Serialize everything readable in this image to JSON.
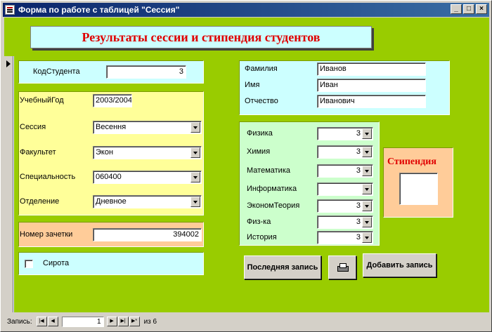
{
  "window": {
    "title": "Форма по работе с таблицей \"Сессия\""
  },
  "header": {
    "title": "Результаты сессии и стипендия студентов"
  },
  "student_id": {
    "label": "КодСтудента",
    "value": "3"
  },
  "session_info": {
    "year_label": "УчебныйГод",
    "year_value": "2003/2004",
    "session_label": "Сессия",
    "session_value": "Весення",
    "faculty_label": "Факультет",
    "faculty_value": "Экон",
    "specialty_label": "Специальность",
    "specialty_value": "060400",
    "department_label": "Отделение",
    "department_value": "Дневное"
  },
  "record_book": {
    "label": "Номер зачетки",
    "value": "394002"
  },
  "orphan": {
    "label": "Сирота"
  },
  "name": {
    "last_label": "Фамилия",
    "last_value": "Иванов",
    "first_label": "Имя",
    "first_value": "Иван",
    "middle_label": "Отчество",
    "middle_value": "Иванович"
  },
  "grades": [
    {
      "label": "Физика",
      "value": "3"
    },
    {
      "label": "Химия",
      "value": "3"
    },
    {
      "label": "Математика",
      "value": "3"
    },
    {
      "label": "Информатика",
      "value": ""
    },
    {
      "label": "ЭкономТеория",
      "value": "3"
    },
    {
      "label": "Физ-ка",
      "value": "3"
    },
    {
      "label": "История",
      "value": "3"
    }
  ],
  "scholarship": {
    "label": "Стипендия"
  },
  "buttons": {
    "last_record": "Последняя запись",
    "add_record": "Добавить запись"
  },
  "navigator": {
    "label": "Запись:",
    "current": "1",
    "of_label": "из 6"
  },
  "colors": {
    "form_bg": "#99cc00",
    "title_red": "#e00000",
    "panel_cyan": "#ccffff",
    "panel_yellow": "#ffff99",
    "panel_peach": "#ffcc99",
    "panel_green": "#ccffcc"
  }
}
